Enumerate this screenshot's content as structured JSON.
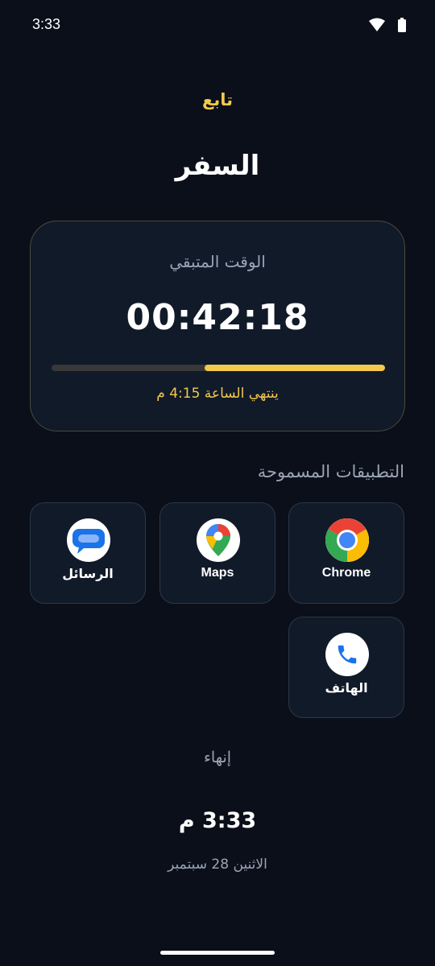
{
  "status_bar": {
    "time": "3:33",
    "icons": [
      "wifi-icon",
      "battery-icon"
    ]
  },
  "header": {
    "follow_label": "تابع",
    "title": "السفر"
  },
  "timer": {
    "label": "الوقت المتبقي",
    "remaining": "00:42:18",
    "progress_fraction": 0.54,
    "ends_at": "ينتهي الساعة 4:15 م",
    "accent_color": "#f2c94c"
  },
  "allowed_apps": {
    "heading": "التطبيقات المسموحة",
    "apps": [
      {
        "label": "Chrome",
        "icon": "chrome-icon"
      },
      {
        "label": "Maps",
        "icon": "maps-icon"
      },
      {
        "label": "الرسائل",
        "icon": "messages-icon"
      },
      {
        "label": "الهاتف",
        "icon": "phone-icon"
      }
    ]
  },
  "end_button": {
    "label": "إنهاء"
  },
  "clock": {
    "time": "3:33 م",
    "date": "الاثنين 28 سبتمبر"
  },
  "colors": {
    "background": "#0a0f1a",
    "card": "#111a29",
    "accent": "#f2c94c",
    "muted_text": "#9aa4b5"
  }
}
